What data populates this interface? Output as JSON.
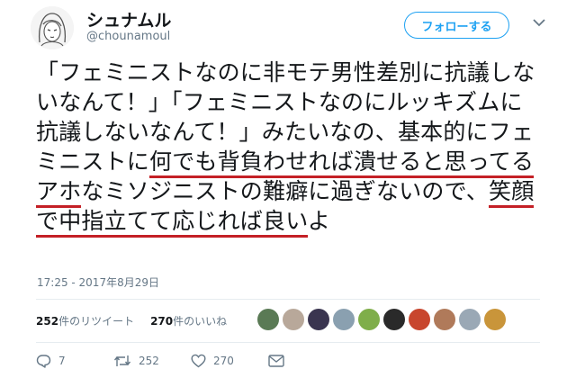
{
  "user": {
    "name": "シュナムル",
    "handle": "@chounamoul"
  },
  "follow_label": "フォローする",
  "tweet": {
    "segments": [
      {
        "text": "「フェミニストなのに非モテ男性差別に抗議しないなんて！」「フェミニストなのにルッキズムに抗議しないなんて！」みたいなの、基本的にフェミニストに",
        "hl": false
      },
      {
        "text": "何でも背負わせれば",
        "hl": true
      },
      {
        "text": "\n",
        "hl": false
      },
      {
        "text": "潰せると思ってるアホ",
        "hl": true
      },
      {
        "text": "なミソジニストの難癖に過ぎないので、",
        "hl": false
      },
      {
        "text": "笑顔で中指立てて応じれば",
        "hl": true
      },
      {
        "text": "\n",
        "hl": false
      },
      {
        "text": "良い",
        "hl": true
      },
      {
        "text": "よ",
        "hl": false
      }
    ]
  },
  "timestamp": "17:25 - 2017年8月29日",
  "stats": {
    "retweets_count": "252",
    "retweets_label": "件のリツイート",
    "likes_count": "270",
    "likes_label": "件のいいね"
  },
  "likers": [
    {
      "name": "liker-1",
      "color": "#5a7a55"
    },
    {
      "name": "liker-2",
      "color": "#b8a89a"
    },
    {
      "name": "liker-3",
      "color": "#3a3550"
    },
    {
      "name": "liker-4",
      "color": "#8aa0b0"
    },
    {
      "name": "liker-5",
      "color": "#7fae4a"
    },
    {
      "name": "liker-6",
      "color": "#2a2a2a"
    },
    {
      "name": "liker-7",
      "color": "#c8462e"
    },
    {
      "name": "liker-8",
      "color": "#b07a5a"
    },
    {
      "name": "liker-9",
      "color": "#9aa8b5"
    },
    {
      "name": "liker-10",
      "color": "#c9953a"
    }
  ],
  "actions": {
    "reply_count": "7",
    "retweet_count": "252",
    "like_count": "270"
  },
  "colors": {
    "accent": "#1da1f2",
    "underline": "#c42026",
    "muted": "#657786"
  }
}
